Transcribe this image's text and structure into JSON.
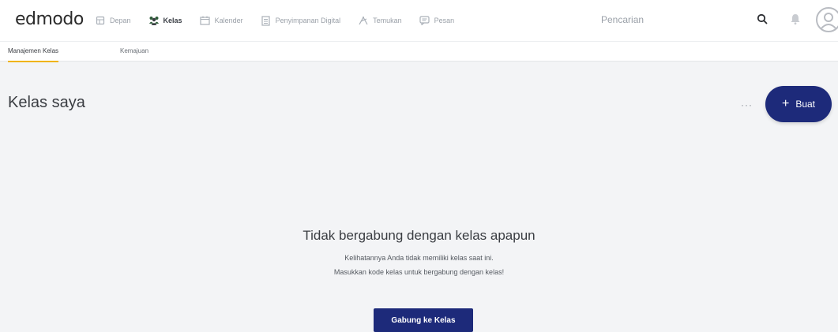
{
  "app": {
    "logo": "edmodo"
  },
  "nav": {
    "items": [
      {
        "label": "Depan",
        "icon": "home-icon",
        "active": false
      },
      {
        "label": "Kelas",
        "icon": "classes-icon",
        "active": true
      },
      {
        "label": "Kalender",
        "icon": "calendar-icon",
        "active": false
      },
      {
        "label": "Penyimpanan Digital",
        "icon": "storage-icon",
        "active": false
      },
      {
        "label": "Temukan",
        "icon": "discover-icon",
        "active": false
      },
      {
        "label": "Pesan",
        "icon": "message-icon",
        "active": false
      }
    ]
  },
  "search": {
    "placeholder": "Pencarian"
  },
  "subnav": {
    "tabs": [
      {
        "label": "Manajemen Kelas",
        "active": true
      },
      {
        "label": "Kemajuan",
        "active": false
      }
    ]
  },
  "main": {
    "title": "Kelas saya",
    "more_label": "···",
    "create_label": "Buat",
    "create_plus": "+"
  },
  "empty": {
    "title": "Tidak bergabung dengan kelas apapun",
    "line1": "Kelihatannya Anda tidak memiliki kelas saat ini.",
    "line2": "Masukkan kode kelas untuk bergabung dengan kelas!",
    "button": "Gabung ke Kelas"
  },
  "colors": {
    "brand": "#1d2a7a",
    "accent": "#f0b400",
    "background": "#f3f4f6"
  }
}
